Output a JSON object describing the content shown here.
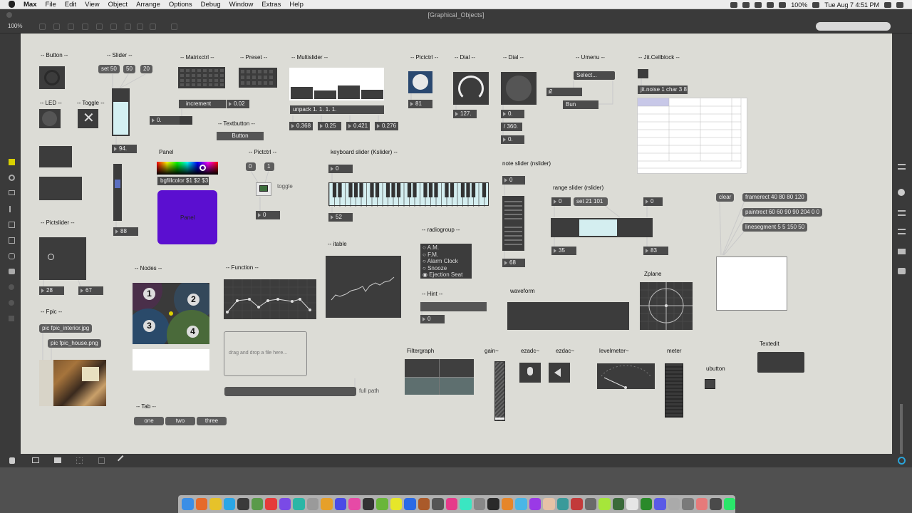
{
  "menubar": {
    "app": "Max",
    "items": [
      "File",
      "Edit",
      "View",
      "Object",
      "Arrange",
      "Options",
      "Debug",
      "Window",
      "Extras",
      "Help"
    ],
    "battery": "100%",
    "clock": "Tue Aug 7  4:51 PM"
  },
  "window": {
    "title": "[Graphical_Objects]",
    "zoom": "100%"
  },
  "labels": {
    "button": "-- Button --",
    "slider": "-- Slider --",
    "matrixctrl": "-- Matrixctrl --",
    "preset": "-- Preset --",
    "multislider": "-- Multislider --",
    "pictctrl": "-- Pictctrl --",
    "dial1": "-- Dial --",
    "dial2": "-- Dial --",
    "umenu": "-- Umenu --",
    "cellblock": "-- Jit.Cellblock --",
    "led": "-- LED --",
    "toggle": "-- Toggle --",
    "textbutton": "-- Textbutton --",
    "panel": "Panel",
    "pictctrl2": "-- Pictctrl --",
    "toggle_label": "toggle",
    "kslider": "keyboard slider (Kslider) --",
    "nslider": "note slider (nslider)",
    "rslider": "range slider (rslider)",
    "pictslider": "-- Pictslider --",
    "nodes": "-- Nodes --",
    "function": "-- Function --",
    "itable": "-- itable",
    "radiogroup": "-- radiogroup --",
    "hint": "-- Hint --",
    "waveform": "waveform",
    "zplane": "Zplane",
    "fpic": "-- Fpic --",
    "filtergraph": "Filtergraph",
    "gain": "gain~",
    "ezadc": "ezadc~",
    "ezdac": "ezdac~",
    "levelmeter": "levelmeter~",
    "meter": "meter",
    "ubutton": "ubutton",
    "textedit": "Textedit",
    "tab": "-- Tab --",
    "dropfile": "drag and drop a file here...",
    "fullpath": "full path"
  },
  "messages": {
    "set50": "set 50",
    "m50": "50",
    "m20": "20",
    "increment": "increment",
    "textbutton": "Button",
    "unpack": "unpack 1. 1. 1. 1.",
    "umenu_sel": "Select...",
    "bun": "Bun",
    "jitnoise": "jit.noise 1 char 3 8",
    "bgfill": "bgfillcolor $1 $2 $3",
    "panel_text": "Panel",
    "pc0": "0",
    "pc1": "1",
    "set21": "set 21 101",
    "clear": "clear",
    "framerect": "framerect 40 80 80 120",
    "paintrect": "paintrect 60 60 90 90 204 0 0",
    "linesegment": "linesegment 5 5 150 50",
    "fpic1": "pic fpic_interior.jpg",
    "fpic2": "pic fpic_house.png",
    "tab1": "one",
    "tab2": "two",
    "tab3": "three"
  },
  "numbers": {
    "matrix_num": "0.02",
    "left0": "0.",
    "pictctrl_out": "81",
    "dial_out": "127.",
    "dial2a": "0.",
    "dial2b": "/ 360.",
    "dial2c": "0.",
    "umenu_num": "2",
    "ms1": "0.368",
    "ms2": "0.25",
    "ms3": "0.421",
    "ms4": "0.276",
    "slider_out": "94.",
    "slider2_out": "88",
    "toggle_out": "0",
    "ks_in": "0",
    "ks_out": "52",
    "ns_in": "0",
    "ns_out": "68",
    "rs_a": "0",
    "rs_b": "0",
    "rs_c": "35",
    "rs_d": "83",
    "ps_a": "28",
    "ps_b": "67",
    "hint_out": "0"
  },
  "radiogroup": [
    "A.M.",
    "F.M.",
    "Alarm Clock",
    "Snooze",
    "Ejection Seat"
  ],
  "nodes": [
    "1",
    "2",
    "3",
    "4"
  ],
  "colors": {
    "accent": "#5b0fd0",
    "cellsel": "#c8c8e8"
  }
}
